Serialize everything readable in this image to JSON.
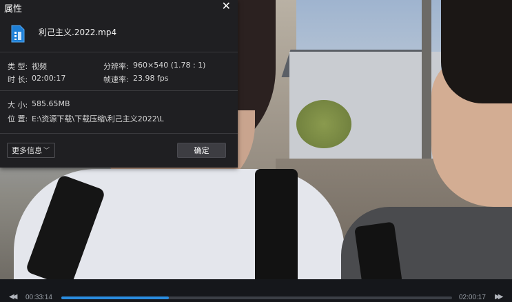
{
  "dialog": {
    "title": "属性",
    "close_glyph": "✕",
    "file_icon": "video-file-icon",
    "file_name": "利己主义.2022.mp4",
    "type_label": "类 型:",
    "type_value": "视频",
    "resolution_label": "分辨率:",
    "resolution_value": "960×540 (1.78 : 1)",
    "duration_label": "时 长:",
    "duration_value": "02:00:17",
    "framerate_label": "帧速率:",
    "framerate_value": "23.98 fps",
    "size_label": "大 小:",
    "size_value": "585.65MB",
    "location_label": "位 置:",
    "location_value": "E:\\资源下载\\下载压缩\\利己主义2022\\L",
    "more_info_label": "更多信息",
    "more_info_chevron": "﹀",
    "ok_label": "确定"
  },
  "player": {
    "prev_glyph": "◀◀",
    "next_glyph": "▶▶",
    "current_time": "00:33:14",
    "total_time": "02:00:17",
    "progress": 0.276,
    "accent_color": "#2a8de0"
  }
}
